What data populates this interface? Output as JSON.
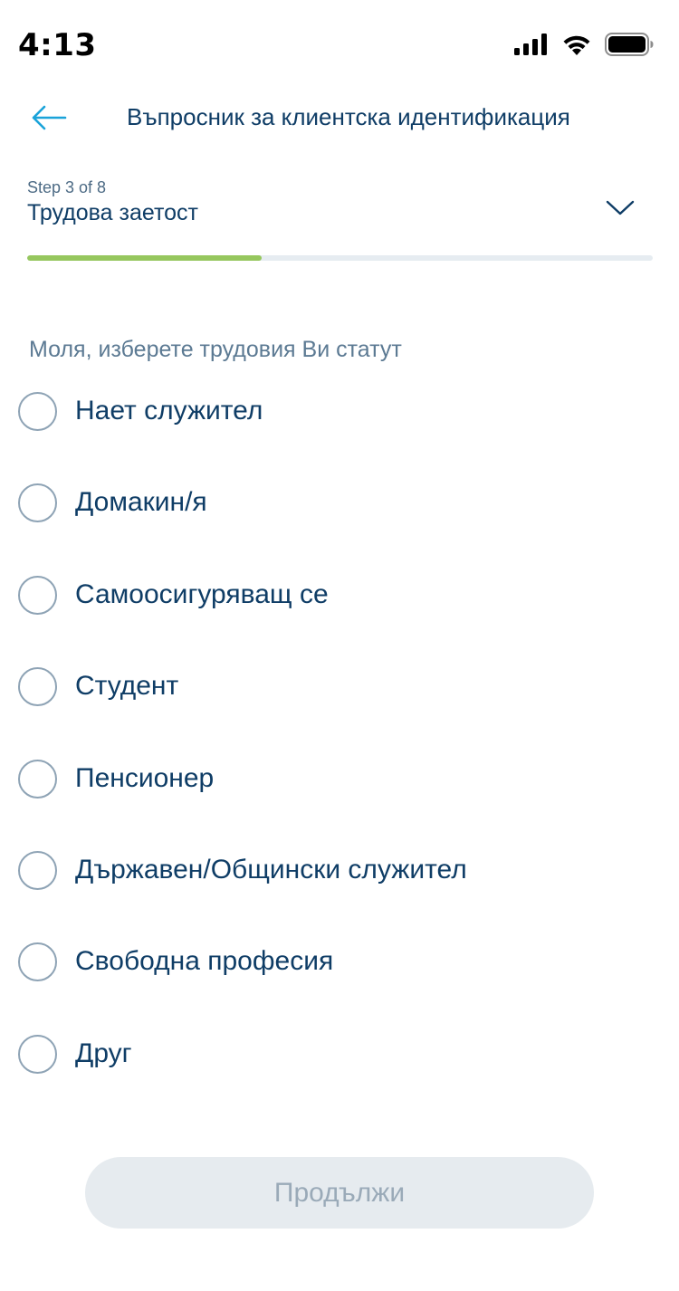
{
  "status_bar": {
    "time": "4:13",
    "icons": [
      "cellular-signal-icon",
      "wifi-icon",
      "battery-icon"
    ]
  },
  "header": {
    "back_icon": "arrow-left-icon",
    "title": "Въпросник за клиентска идентификация"
  },
  "step": {
    "label": "Step 3 of 8",
    "title": "Трудова заетост",
    "current": 3,
    "total": 8,
    "progress_fraction": 0.375,
    "expand_icon": "chevron-down-icon"
  },
  "question": "Моля, изберете трудовия Ви статут",
  "options": [
    {
      "label": "Нает служител",
      "selected": false
    },
    {
      "label": "Домакин/я",
      "selected": false
    },
    {
      "label": "Самоосигуряващ се",
      "selected": false
    },
    {
      "label": "Студент",
      "selected": false
    },
    {
      "label": "Пенсионер",
      "selected": false
    },
    {
      "label": "Държавен/Общински служител",
      "selected": false
    },
    {
      "label": "Свободна професия",
      "selected": false
    },
    {
      "label": "Друг",
      "selected": false
    }
  ],
  "continue_button": {
    "label": "Продължи",
    "enabled": false
  },
  "colors": {
    "text_primary": "#0f3d66",
    "accent_blue": "#1aa3d9",
    "progress_green": "#96c75e",
    "radio_border": "#8ea3b5",
    "button_disabled_bg": "#e6ebef",
    "button_disabled_text": "#9aaab8"
  }
}
